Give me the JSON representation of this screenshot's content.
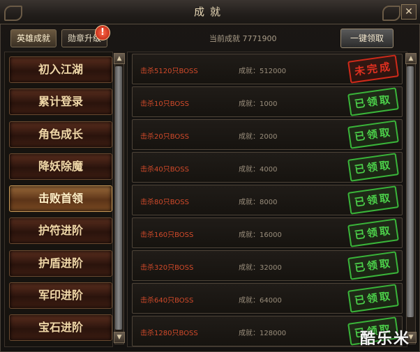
{
  "window": {
    "title": "成就",
    "close_glyph": "✕"
  },
  "tabs": [
    {
      "label": "英雄成就",
      "active": true
    },
    {
      "label": "勋章升级",
      "active": false
    }
  ],
  "notification_badge": "!",
  "total_achievement": "当前成就 7771900",
  "claim_all_label": "一键领取",
  "categories": [
    {
      "label": "初入江湖",
      "active": false
    },
    {
      "label": "累计登录",
      "active": false
    },
    {
      "label": "角色成长",
      "active": false
    },
    {
      "label": "降妖除魔",
      "active": false
    },
    {
      "label": "击败首领",
      "active": true
    },
    {
      "label": "护符进阶",
      "active": false
    },
    {
      "label": "护盾进阶",
      "active": false
    },
    {
      "label": "军印进阶",
      "active": false
    },
    {
      "label": "宝石进阶",
      "active": false
    }
  ],
  "achievements": [
    {
      "task": "击杀5120只BOSS",
      "score": "成就：512000",
      "status": "未完成",
      "status_type": "incomplete"
    },
    {
      "task": "击杀10只BOSS",
      "score": "成就：1000",
      "status": "已领取",
      "status_type": "claimed"
    },
    {
      "task": "击杀20只BOSS",
      "score": "成就：2000",
      "status": "已领取",
      "status_type": "claimed"
    },
    {
      "task": "击杀40只BOSS",
      "score": "成就：4000",
      "status": "已领取",
      "status_type": "claimed"
    },
    {
      "task": "击杀80只BOSS",
      "score": "成就：8000",
      "status": "已领取",
      "status_type": "claimed"
    },
    {
      "task": "击杀160只BOSS",
      "score": "成就：16000",
      "status": "已领取",
      "status_type": "claimed"
    },
    {
      "task": "击杀320只BOSS",
      "score": "成就：32000",
      "status": "已领取",
      "status_type": "claimed"
    },
    {
      "task": "击杀640只BOSS",
      "score": "成就：64000",
      "status": "已领取",
      "status_type": "claimed"
    },
    {
      "task": "击杀1280只BOSS",
      "score": "成就：128000",
      "status": "已领取",
      "status_type": "claimed"
    }
  ],
  "scroll_arrows": {
    "up": "▲",
    "down": "▼"
  },
  "watermark": "酷乐米",
  "colors": {
    "task_text": "#d24a2a",
    "claimed_stamp": "#4cd04a",
    "incomplete_stamp": "#e03020",
    "active_category": "#9a6a3a"
  }
}
